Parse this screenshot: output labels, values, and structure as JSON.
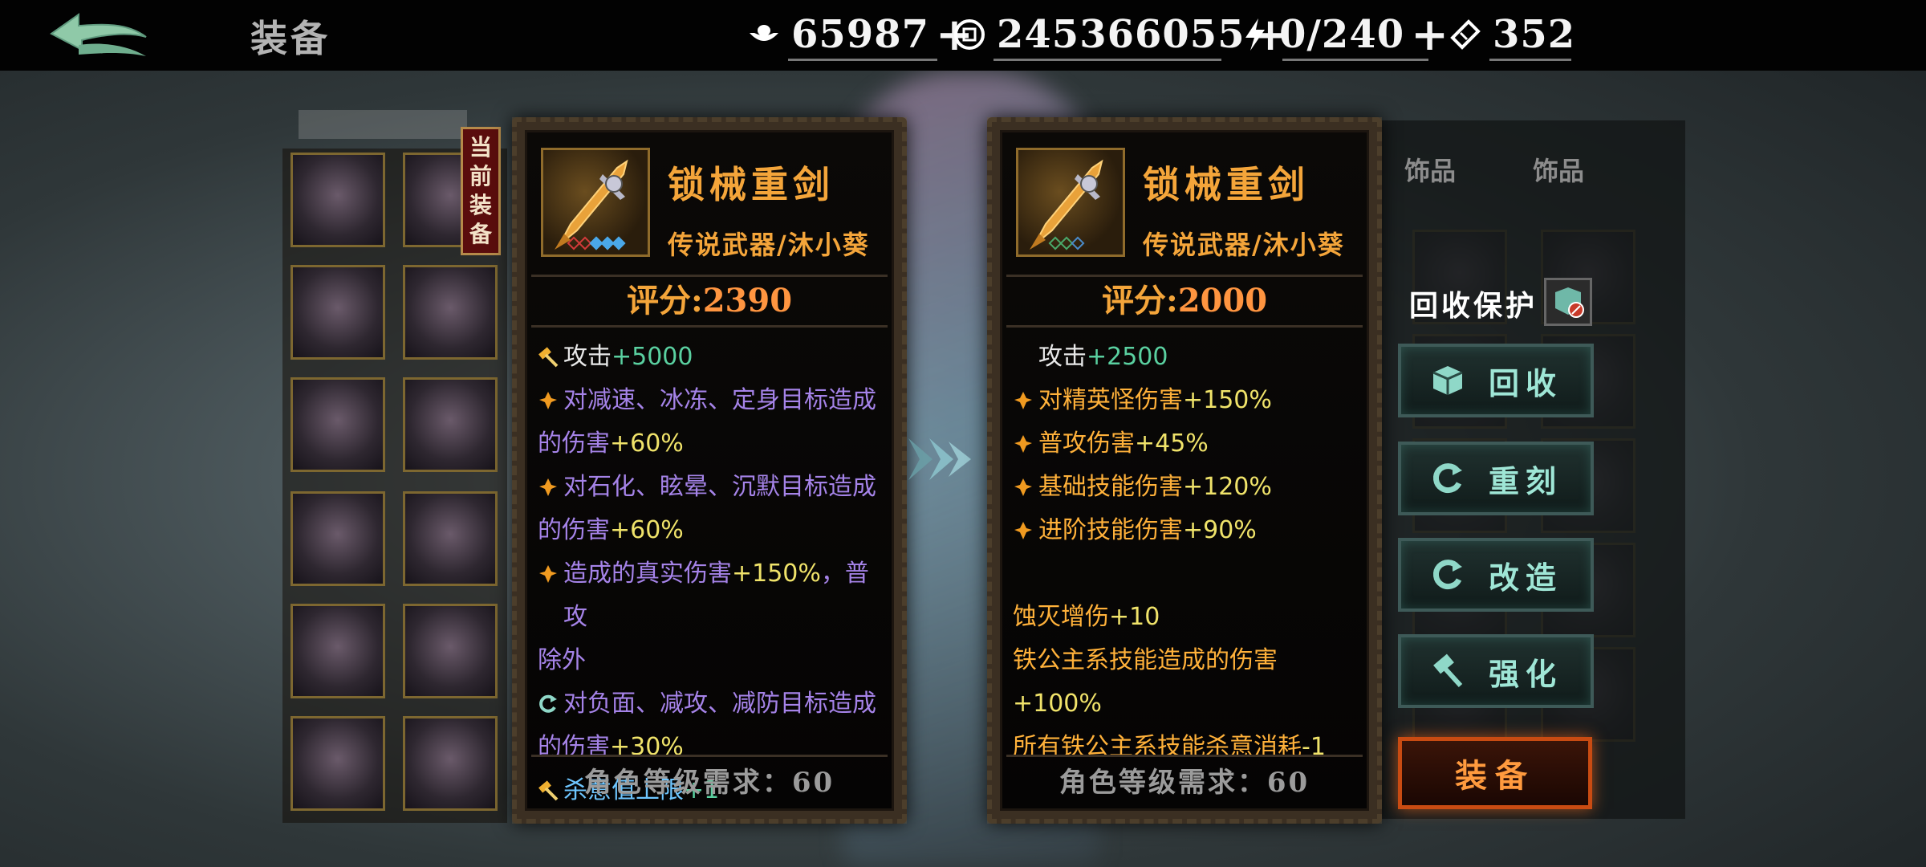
{
  "header": {
    "title": "装备",
    "resources": [
      {
        "icon": "silver-ingot-icon",
        "value": "65987",
        "plus": "+"
      },
      {
        "icon": "coin-icon",
        "value": "245366055",
        "plus": "+"
      },
      {
        "icon": "lightning-icon",
        "value": "0/240",
        "plus": "+"
      },
      {
        "icon": "ticket-icon",
        "value": "352",
        "plus": ""
      }
    ]
  },
  "current_tag": [
    "当",
    "前",
    "装",
    "备"
  ],
  "current_item": {
    "name": "锁械重剑",
    "subtitle": "传说武器/沐小葵",
    "score_label": "评分:",
    "score": "2390",
    "attributes": [
      {
        "icon": "hammer-icon",
        "parts": [
          {
            "text": "攻击",
            "c": "white"
          },
          {
            "text": "+5000",
            "c": "green"
          }
        ]
      },
      {
        "icon": "flame-icon",
        "parts": [
          {
            "text": "对减速、冰冻、定身目标造成",
            "c": "purple"
          }
        ]
      },
      {
        "icon": "",
        "parts": [
          {
            "text": "的伤害",
            "c": "purple"
          },
          {
            "text": "+60%",
            "c": "yellow"
          }
        ]
      },
      {
        "icon": "flame-icon",
        "parts": [
          {
            "text": "对石化、眩晕、沉默目标造成",
            "c": "purple"
          }
        ]
      },
      {
        "icon": "",
        "parts": [
          {
            "text": "的伤害",
            "c": "purple"
          },
          {
            "text": "+60%",
            "c": "yellow"
          }
        ]
      },
      {
        "icon": "flame-icon",
        "parts": [
          {
            "text": "造成的真实伤害",
            "c": "purple"
          },
          {
            "text": "+150%",
            "c": "yellow"
          },
          {
            "text": "，普攻",
            "c": "purple"
          }
        ]
      },
      {
        "icon": "",
        "parts": [
          {
            "text": "除外",
            "c": "purple"
          }
        ]
      },
      {
        "icon": "refresh-icon",
        "parts": [
          {
            "text": "对负面、减攻、减防目标造成",
            "c": "purple"
          }
        ]
      },
      {
        "icon": "",
        "parts": [
          {
            "text": "的伤害",
            "c": "purple"
          },
          {
            "text": "+30%",
            "c": "yellow"
          }
        ]
      },
      {
        "icon": "hammer-icon",
        "parts": [
          {
            "text": "杀意值上限",
            "c": "blue"
          },
          {
            "text": "+1",
            "c": "green"
          }
        ]
      }
    ],
    "requirement": "角色等级需求：60"
  },
  "compare_item": {
    "name": "锁械重剑",
    "subtitle": "传说武器/沐小葵",
    "score_label": "评分:",
    "score": "2000",
    "attributes": [
      {
        "icon": "blank",
        "parts": [
          {
            "text": "攻击",
            "c": "white"
          },
          {
            "text": "+2500",
            "c": "green"
          }
        ]
      },
      {
        "icon": "flame-icon",
        "parts": [
          {
            "text": "对精英怪伤害",
            "c": "orange"
          },
          {
            "text": "+150%",
            "c": "yellow"
          }
        ]
      },
      {
        "icon": "flame-icon",
        "parts": [
          {
            "text": "普攻伤害",
            "c": "orange"
          },
          {
            "text": "+45%",
            "c": "yellow"
          }
        ]
      },
      {
        "icon": "flame-icon",
        "parts": [
          {
            "text": "基础技能伤害",
            "c": "orange"
          },
          {
            "text": "+120%",
            "c": "yellow"
          }
        ]
      },
      {
        "icon": "flame-icon",
        "parts": [
          {
            "text": "进阶技能伤害",
            "c": "orange"
          },
          {
            "text": "+90%",
            "c": "yellow"
          }
        ]
      },
      {
        "icon": "gap",
        "parts": []
      },
      {
        "icon": "",
        "parts": [
          {
            "text": "蚀灭增伤",
            "c": "orange"
          },
          {
            "text": "+10",
            "c": "yellow"
          }
        ]
      },
      {
        "icon": "",
        "parts": [
          {
            "text": "铁公主系技能造成的伤害",
            "c": "orange"
          },
          {
            "text": "+100%",
            "c": "yellow"
          }
        ]
      },
      {
        "icon": "",
        "parts": [
          {
            "text": "所有铁公主系技能杀意消耗",
            "c": "orange"
          },
          {
            "text": "-1",
            "c": "yellow"
          }
        ]
      }
    ],
    "requirement": "角色等级需求：60"
  },
  "right_panel": {
    "tabs": [
      "饰品",
      "饰品"
    ],
    "protect_label": "回收保护",
    "buttons": [
      {
        "label": "回收",
        "icon": "recycle-icon"
      },
      {
        "label": "重刻",
        "icon": "refresh-icon"
      },
      {
        "label": "改造",
        "icon": "refresh-icon"
      },
      {
        "label": "强化",
        "icon": "hammer-icon"
      }
    ],
    "equip_label": "装备"
  },
  "colors": {
    "orange_title": "#f4a53a",
    "purple": "#a583e8",
    "yellow": "#f0e36a",
    "teal": "#9fe6d6",
    "equip": "#ff9a3e"
  }
}
